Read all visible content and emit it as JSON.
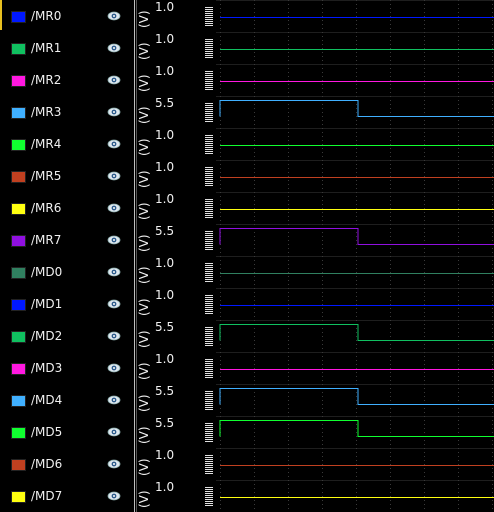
{
  "signals": [
    {
      "name": "/MR0",
      "color": "#0018ff",
      "max": "1.0",
      "level": 0.0,
      "step": false
    },
    {
      "name": "/MR1",
      "color": "#10c060",
      "max": "1.0",
      "level": 0.0,
      "step": false
    },
    {
      "name": "/MR2",
      "color": "#ff18e0",
      "max": "1.0",
      "level": 0.0,
      "step": false
    },
    {
      "name": "/MR3",
      "color": "#40b0ff",
      "max": "5.5",
      "level": 1.0,
      "step": true
    },
    {
      "name": "/MR4",
      "color": "#10ff30",
      "max": "1.0",
      "level": 0.0,
      "step": false
    },
    {
      "name": "/MR5",
      "color": "#c04020",
      "max": "1.0",
      "level": 0.0,
      "step": false
    },
    {
      "name": "/MR6",
      "color": "#ffff10",
      "max": "1.0",
      "level": 0.0,
      "step": false
    },
    {
      "name": "/MR7",
      "color": "#9010e0",
      "max": "5.5",
      "level": 1.0,
      "step": true
    },
    {
      "name": "/MD0",
      "color": "#308060",
      "max": "1.0",
      "level": 0.0,
      "step": false
    },
    {
      "name": "/MD1",
      "color": "#0018ff",
      "max": "1.0",
      "level": 0.0,
      "step": false
    },
    {
      "name": "/MD2",
      "color": "#10c060",
      "max": "5.5",
      "level": 1.0,
      "step": true
    },
    {
      "name": "/MD3",
      "color": "#ff18e0",
      "max": "1.0",
      "level": 0.0,
      "step": false
    },
    {
      "name": "/MD4",
      "color": "#40b0ff",
      "max": "5.5",
      "level": 1.0,
      "step": true
    },
    {
      "name": "/MD5",
      "color": "#10ff30",
      "max": "5.5",
      "level": 1.0,
      "step": true
    },
    {
      "name": "/MD6",
      "color": "#c04020",
      "max": "1.0",
      "level": 0.0,
      "step": false
    },
    {
      "name": "/MD7",
      "color": "#ffff10",
      "max": "1.0",
      "level": 0.0,
      "step": false
    }
  ],
  "axis_label": "(V)",
  "colors": {
    "grid": "#3a3a3a",
    "separator": "#bfbfbf",
    "background": "#000000",
    "focus": "#e8c020"
  }
}
